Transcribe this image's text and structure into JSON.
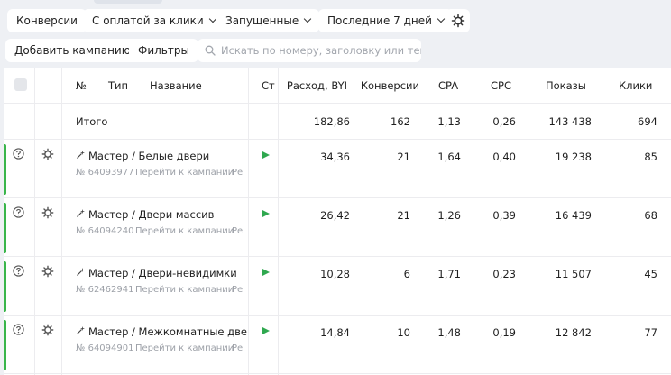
{
  "filters": {
    "conversions": "Конверсии",
    "payment": "С оплатой за клики",
    "status": "Запущенные",
    "period": "Последние 7 дней"
  },
  "toolbar": {
    "add_campaign": "Добавить кампанию",
    "filters": "Фильтры",
    "search_placeholder": "Искать по номеру, заголовку или тексту"
  },
  "columns": {
    "number": "№",
    "type": "Тип",
    "name": "Название",
    "status": "Ст",
    "spend": "Расход, BYI",
    "conversions": "Конверсии",
    "cpa": "CPA",
    "cpc": "CPC",
    "impressions": "Показы",
    "clicks": "Клики"
  },
  "total": {
    "label": "Итого",
    "spend": "182,86",
    "conversions": "162",
    "cpa": "1,13",
    "cpc": "0,26",
    "impressions": "143 438",
    "clicks": "694"
  },
  "campaigns": [
    {
      "name": "Мастер / Белые двери",
      "number": "№ 64093977",
      "link": "Перейти к кампании",
      "edit": "Ре",
      "spend": "34,36",
      "conversions": "21",
      "cpa": "1,64",
      "cpc": "0,40",
      "impressions": "19 238",
      "clicks": "85"
    },
    {
      "name": "Мастер / Двери массив",
      "number": "№ 64094240",
      "link": "Перейти к кампании",
      "edit": "Ре",
      "spend": "26,42",
      "conversions": "21",
      "cpa": "1,26",
      "cpc": "0,39",
      "impressions": "16 439",
      "clicks": "68"
    },
    {
      "name": "Мастер / Двери-невидимки",
      "number": "№ 62462941",
      "link": "Перейти к кампании",
      "edit": "Ре",
      "spend": "10,28",
      "conversions": "6",
      "cpa": "1,71",
      "cpc": "0,23",
      "impressions": "11 507",
      "clicks": "45"
    },
    {
      "name": "Мастер / Межкомнатные двери",
      "number": "№ 64094901",
      "link": "Перейти к кампании",
      "edit": "Ре",
      "spend": "14,84",
      "conversions": "10",
      "cpa": "1,48",
      "cpc": "0,19",
      "impressions": "12 842",
      "clicks": "77"
    }
  ],
  "colors": {
    "status_active": "#39b54a",
    "play": "#2fa84f",
    "muted": "#9da1a8",
    "background": "#eef0f4"
  },
  "icons": {
    "help": "help-circle-icon",
    "settings": "gear-icon",
    "campaign_type": "master-wand-icon",
    "status": "play-icon",
    "search": "search-icon"
  }
}
